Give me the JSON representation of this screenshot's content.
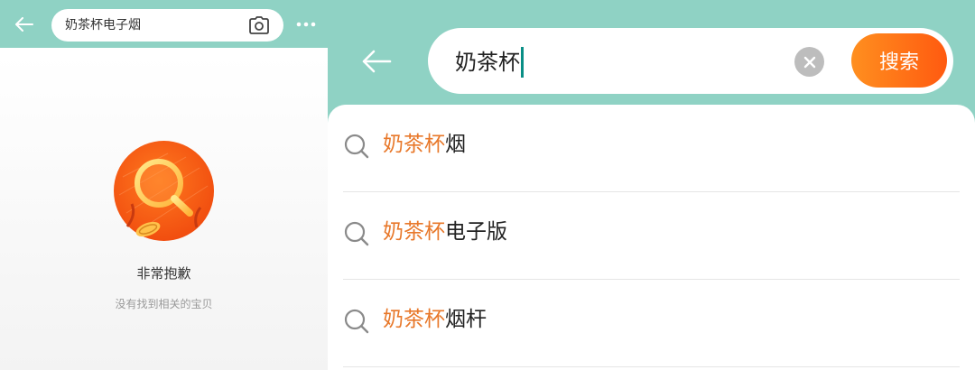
{
  "left_panel": {
    "search_query": "奶茶杯电子烟",
    "icons": {
      "back": "back-arrow-icon",
      "camera": "camera-icon",
      "more": "more-dots-icon",
      "empty": "magnifier-illustration-icon"
    },
    "empty_state": {
      "title": "非常抱歉",
      "subtitle": "没有找到相关的宝贝"
    }
  },
  "right_panel": {
    "search_input": "奶茶杯",
    "search_button_label": "搜索",
    "icons": {
      "back": "back-arrow-icon",
      "clear": "clear-icon",
      "suggestion": "search-icon"
    },
    "suggestions": [
      {
        "highlight": "奶茶杯",
        "rest": "烟"
      },
      {
        "highlight": "奶茶杯",
        "rest": "电子版"
      },
      {
        "highlight": "奶茶杯",
        "rest": "烟杆"
      }
    ]
  },
  "colors": {
    "header_teal": "#8fd2c4",
    "highlight_orange": "#e8782a",
    "search_button_gradient": [
      "#ff8f1f",
      "#ff5a10"
    ],
    "caret": "#0a8f86"
  }
}
